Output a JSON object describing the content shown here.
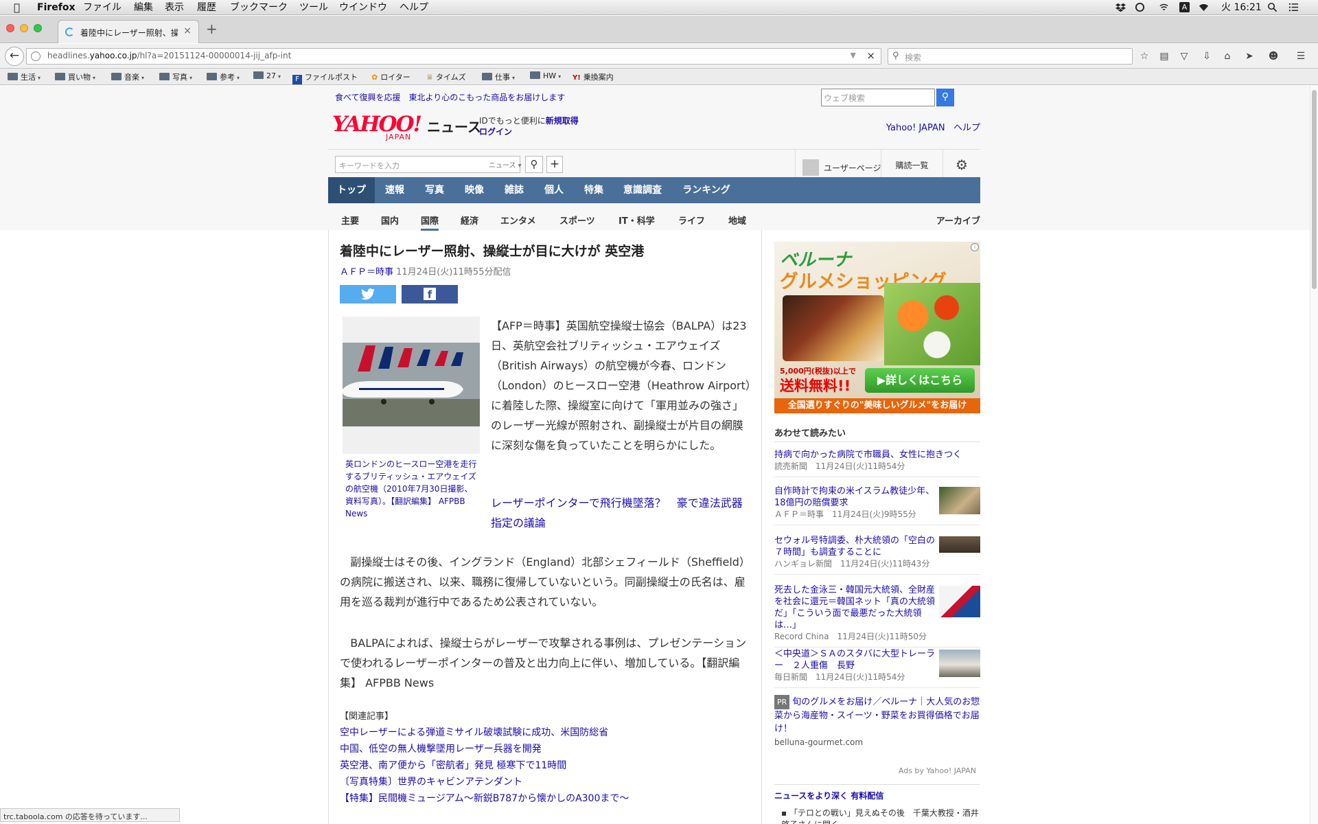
{
  "menubar": {
    "app": "Firefox",
    "items": [
      "ファイル",
      "編集",
      "表示",
      "履歴",
      "ブックマーク",
      "ツール",
      "ウインドウ",
      "ヘルプ"
    ],
    "clock": "火 16:21"
  },
  "tab": {
    "title": "着陸中にレーザー照射、操縦士が目に大けが 英空港"
  },
  "url": {
    "domain": "headlines.yahoo.co.jp",
    "path": "/hl?a=20151124-00000014-jij_afp-int",
    "prefix": "headlines."
  },
  "search": {
    "placeholder": "検索"
  },
  "bookmarks": [
    {
      "label": "生活",
      "folder": true
    },
    {
      "label": "買い物",
      "folder": true
    },
    {
      "label": "音楽",
      "folder": true
    },
    {
      "label": "写真",
      "folder": true
    },
    {
      "label": "参考",
      "folder": true
    },
    {
      "label": "27",
      "folder": true
    },
    {
      "label": "ファイルポスト",
      "folder": false
    },
    {
      "label": "ロイター",
      "folder": false
    },
    {
      "label": "タイムズ",
      "folder": false
    },
    {
      "label": "仕事",
      "folder": true
    },
    {
      "label": "HW",
      "folder": true
    },
    {
      "label": "乗換案内",
      "folder": false
    }
  ],
  "yahoo": {
    "promo": "食べて復興を応援　東北より心のこもった商品をお届けします",
    "web_search_placeholder": "ウェブ検索",
    "logo": "YAHOO!",
    "logo_sub": "JAPAN",
    "news_label": "ニュース",
    "id_line1": "IDでもっと便利に",
    "id_register": "新規取得",
    "id_login": "ログイン",
    "link_yahoo": "Yahoo! JAPAN",
    "link_help": "ヘルプ",
    "keyword_placeholder": "キーワードを入力",
    "keyword_scope": "ニュース",
    "user_page": "ユーザーページ",
    "subscriptions": "購読一覧",
    "global_nav": [
      "トップ",
      "速報",
      "写真",
      "映像",
      "雑誌",
      "個人",
      "特集",
      "意識調査",
      "ランキング"
    ],
    "sub_nav": [
      "主要",
      "国内",
      "国際",
      "経済",
      "エンタメ",
      "スポーツ",
      "IT・科学",
      "ライフ",
      "地域"
    ],
    "archive": "アーカイブ"
  },
  "article": {
    "title": "着陸中にレーザー照射、操縦士が目に大けが 英空港",
    "source": "ＡＦＰ＝時事",
    "date": "11月24日(火)11時55分配信",
    "caption": "英ロンドンのヒースロー空港を走行するブリティッシュ・エアウェイズの航空機（2010年7月30日撮影、資料写真）。【翻訳編集】 AFPBB News",
    "p1": "【AFP＝時事】英国航空操縦士協会（BALPA）は23日、英航空会社ブリティッシュ・エアウェイズ（British Airways）の航空機が今春、ロンドン（London）のヒースロー空港（Heathrow Airport）に着陸した際、操縦室に向けて「軍用並みの強さ」のレーザー光線が照射され、副操縦士が片目の網膜に深刻な傷を負っていたことを明らかにした。",
    "related_link": "レーザーポインターで飛行機墜落？　豪で違法武器指定の議論",
    "p2": "副操縦士はその後、イングランド（England）北部シェフィールド（Sheffield）の病院に搬送され、以来、職務に復帰していないという。同副操縦士の氏名は、雇用を巡る裁判が進行中であるため公表されていない。",
    "p3": "BALPAによれば、操縦士らがレーザーで攻撃される事例は、プレゼンテーションで使われるレーザーポインターの普及と出力向上に伴い、増加している。【翻訳編集】 AFPBB News",
    "related_heading": "【関連記事】",
    "related": [
      "空中レーザーによる弾道ミサイル破壊試験に成功、米国防総省",
      "中国、低空の無人機撃墜用レーザー兵器を開発",
      "英空港、南ア便から「密航者」発見 極寒下で11時間",
      "〔写真特集〕世界のキャビンアテンダント",
      "【特集】民間機ミュージアム〜新鋭B787から懐かしのA300まで〜"
    ]
  },
  "ad": {
    "brand": "ベルーナ",
    "headline": "グルメショッピング",
    "cond": "5,000円(税抜)以上で",
    "free": "送料無料!!",
    "button": "詳しくはこちら",
    "footer": "全国選りすぐりの\"美味しいグルメ\"をお届け"
  },
  "sidebar": {
    "heading": "あわせて読みたい",
    "items": [
      {
        "title": "持病で向かった病院で市職員、女性に抱きつく",
        "meta": "読売新聞　11月24日(火)11時54分"
      },
      {
        "title": "自作時計で拘束の米イスラム教徒少年、18億円の賠償要求",
        "meta": "ＡＦＰ＝時事　11月24日(火)9時55分"
      },
      {
        "title": "セウォル号特調委、朴大統領の「空白の７時間」も調査することに",
        "meta": "ハンギョレ新聞　11月24日(火)11時43分"
      },
      {
        "title": "死去した金泳三・韓国元大統領、全財産を社会に還元＝韓国ネット「真の大統領だ」「こういう面で最悪だった大統領は…」",
        "meta": "Record China　11月24日(火)11時50分"
      },
      {
        "title": "＜中央道＞ＳＡのスタバに大型トレーラー　２人重傷　長野",
        "meta": "毎日新聞　11月24日(火)11時54分"
      }
    ],
    "pr_label": "PR",
    "pr_title": "旬のグルメをお届け／ベルーナ｜大人気のお惣菜から海産物・スイーツ・野菜をお買得価格でお届け！",
    "pr_domain": "belluna-gourmet.com",
    "ads_by": "Ads by Yahoo! JAPAN",
    "deep_heading": "ニュースをより深く 有料配信",
    "deep_item": "「テロとの戦い」見えぬその後　千葉大教授・酒井啓子さんに聞く"
  },
  "status": "trc.taboola.com の応答を待っています..."
}
